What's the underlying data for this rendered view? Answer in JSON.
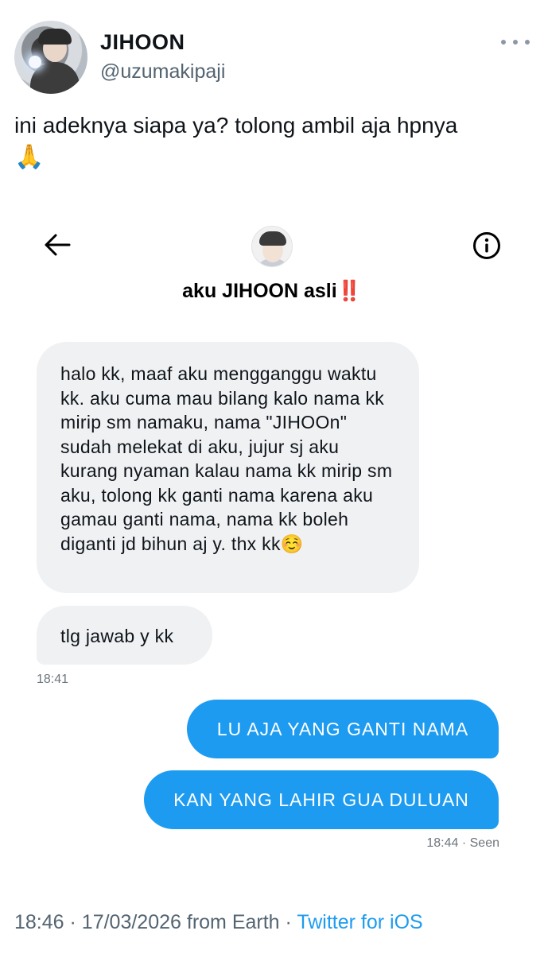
{
  "tweet": {
    "display_name": "JIHOON",
    "handle": "@uzumakipaji",
    "text": "ini adeknya siapa ya? tolong ambil aja hpnya",
    "emoji": "🙏",
    "time": "18:46",
    "separator": "·",
    "date": "17/03/2026",
    "location": "from Earth",
    "source": "Twitter for iOS"
  },
  "dm": {
    "title": "aku JIHOON asli",
    "title_emoji": "‼️",
    "messages": [
      {
        "direction": "in",
        "text": "halo kk, maaf aku mengganggu waktu kk. aku cuma mau bilang kalo nama kk mirip sm namaku, nama \"JIHOOn\" sudah melekat di aku, jujur sj aku kurang nyaman kalau nama kk mirip sm aku, tolong kk ganti nama karena aku gamau ganti nama, nama kk boleh diganti jd bihun aj y. thx kk",
        "emoji": "☺️"
      },
      {
        "direction": "in",
        "text": "tlg jawab y kk"
      },
      {
        "direction": "out",
        "text": "LU AJA YANG GANTI NAMA"
      },
      {
        "direction": "out",
        "text": "KAN YANG LAHIR GUA DULUAN"
      }
    ],
    "time_in": "18:41",
    "time_out": "18:44 · Seen"
  },
  "colors": {
    "accent": "#1d9bf0",
    "incoming_bubble": "#eff1f3",
    "secondary_text": "#536471",
    "alert_red": "#e0162b"
  },
  "icons": [
    "more-icon",
    "back-arrow-icon",
    "info-icon",
    "praying-hands-emoji",
    "smiling-face-emoji"
  ]
}
